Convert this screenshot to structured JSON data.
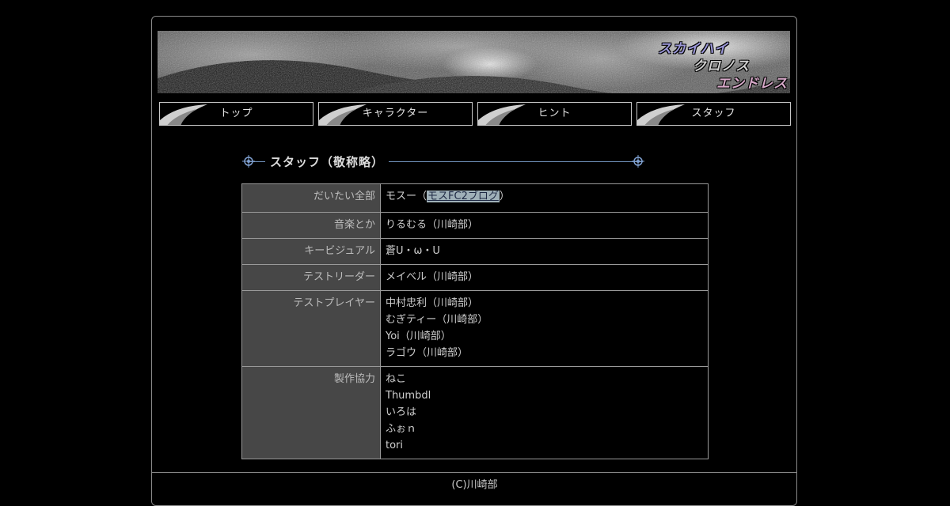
{
  "banner": {
    "logo_lines": [
      "スカイハイ",
      "クロノス",
      "エンドレス"
    ]
  },
  "nav": {
    "items": [
      {
        "label": "トップ"
      },
      {
        "label": "キャラクター"
      },
      {
        "label": "ヒント"
      },
      {
        "label": "スタッフ"
      }
    ]
  },
  "section": {
    "title": "スタッフ（敬称略）"
  },
  "staff": {
    "rows": [
      {
        "role": "だいたい全部",
        "name_prefix": "モスー（",
        "link": "モスFC2ブログ",
        "name_suffix": "）"
      },
      {
        "role": "音楽とか",
        "names": [
          "りるむる（川崎部）"
        ]
      },
      {
        "role": "キービジュアル",
        "names": [
          "蒼U・ω・U"
        ]
      },
      {
        "role": "テストリーダー",
        "names": [
          "メイベル（川崎部）"
        ]
      },
      {
        "role": "テストプレイヤー",
        "names": [
          "中村忠利（川崎部）",
          "むぎティー（川崎部）",
          "Yoi（川崎部）",
          "ラゴウ（川崎部）"
        ]
      },
      {
        "role": "製作協力",
        "names": [
          "ねこ",
          "Thumbdl",
          "いろは",
          "ふぉｎ",
          "tori"
        ]
      }
    ]
  },
  "footer": {
    "copyright": "(C)川崎部"
  },
  "colors": {
    "background": "#000000",
    "role_cell": "#474747",
    "border": "#9a9a9a",
    "accent_line": "#6f8fb8"
  }
}
